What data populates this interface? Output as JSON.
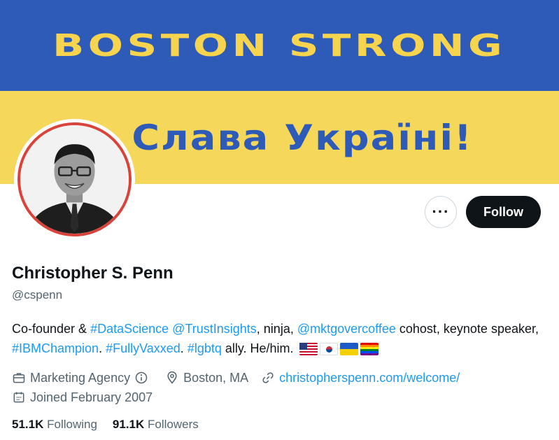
{
  "banner": {
    "line1": "BOSTON STRONG",
    "line2": "Слава Україні!",
    "top_color": "#2f5bb8",
    "bottom_color": "#f5d75a"
  },
  "actions": {
    "more_label": "···",
    "follow_label": "Follow"
  },
  "profile": {
    "name": "Christopher S. Penn",
    "handle": "@cspenn",
    "bio": {
      "t1": "Co-founder & ",
      "l1": "#DataScience",
      "t2": " ",
      "l2": "@TrustInsights",
      "t3": ", ninja, ",
      "l3": "@mktgovercoffee",
      "t4": " cohost, keynote speaker, ",
      "l4": "#IBMChampion",
      "t5": ". ",
      "l5": "#FullyVaxxed",
      "t6": ". ",
      "l6": "#lgbtq",
      "t7": " ally. He/him."
    },
    "flags": [
      "us-flag-icon",
      "korea-flag-icon",
      "ukraine-flag-icon",
      "rainbow-flag-icon"
    ],
    "category": "Marketing Agency",
    "location": "Boston, MA",
    "website": "christopherspenn.com/welcome/",
    "joined": "Joined February 2007"
  },
  "stats": {
    "following_count": "51.1K",
    "following_label": "Following",
    "followers_count": "91.1K",
    "followers_label": "Followers"
  },
  "colors": {
    "link": "#1d9bf0",
    "avatar_ring": "#d9433a"
  }
}
